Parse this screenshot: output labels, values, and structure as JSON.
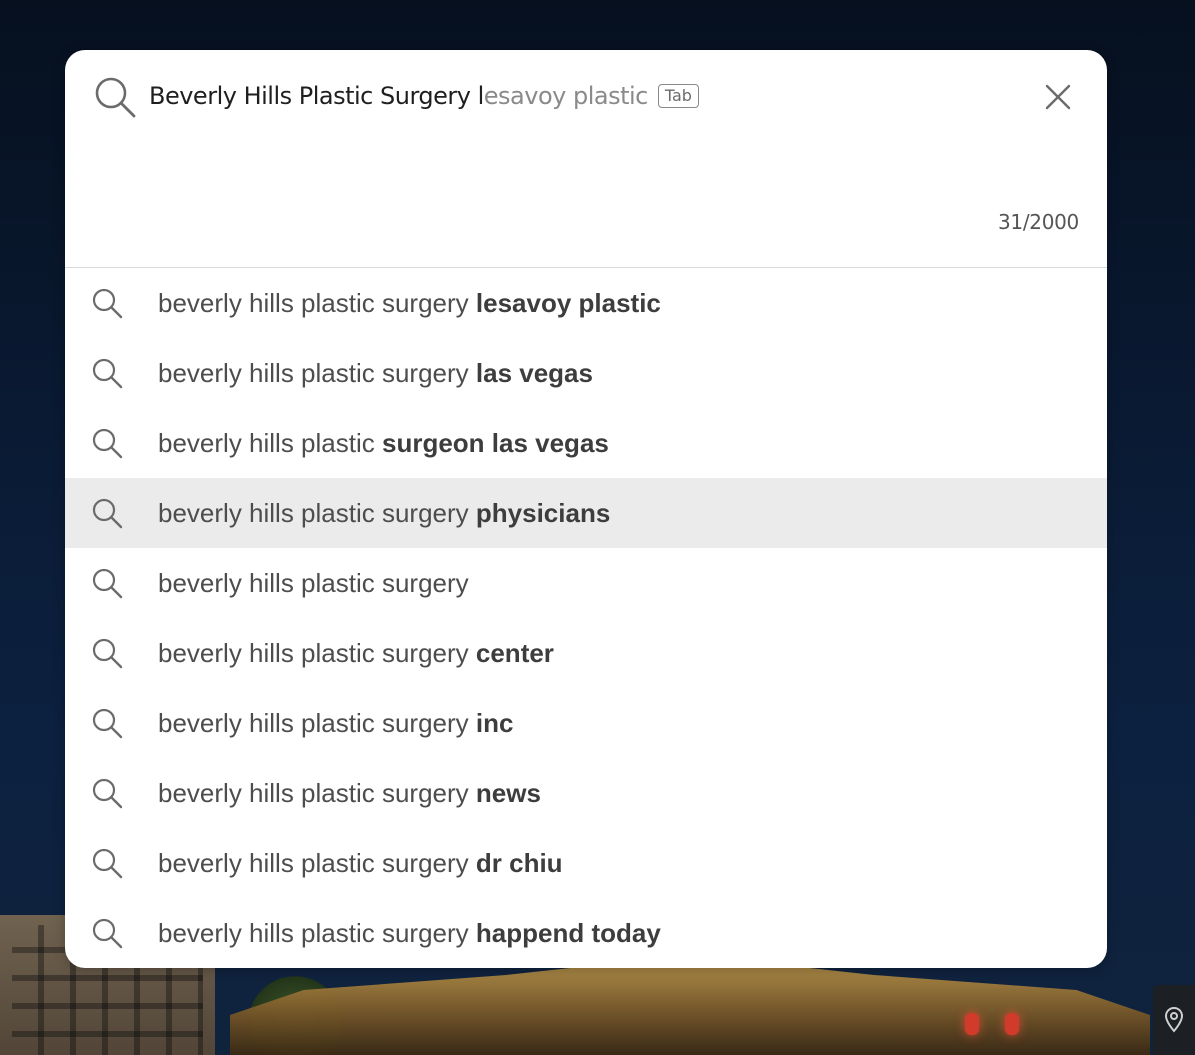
{
  "search": {
    "typed_text": "Beverly Hills Plastic Surgery l",
    "completion_text": "esavoy plastic",
    "tab_hint": "Tab",
    "char_counter": "31/2000"
  },
  "suggestions": [
    {
      "prefix": "beverly hills plastic surgery ",
      "bold": "lesavoy plastic",
      "highlighted": false
    },
    {
      "prefix": "beverly hills plastic surgery ",
      "bold": "las vegas",
      "highlighted": false
    },
    {
      "prefix": "beverly hills plastic ",
      "bold": "surgeon las vegas",
      "highlighted": false
    },
    {
      "prefix": "beverly hills plastic surgery ",
      "bold": "physicians",
      "highlighted": true
    },
    {
      "prefix": "beverly hills plastic surgery",
      "bold": "",
      "highlighted": false
    },
    {
      "prefix": "beverly hills plastic surgery ",
      "bold": "center",
      "highlighted": false
    },
    {
      "prefix": "beverly hills plastic surgery ",
      "bold": "inc",
      "highlighted": false
    },
    {
      "prefix": "beverly hills plastic surgery ",
      "bold": "news",
      "highlighted": false
    },
    {
      "prefix": "beverly hills plastic surgery ",
      "bold": "dr chiu",
      "highlighted": false
    },
    {
      "prefix": "beverly hills plastic surgery ",
      "bold": "happend today",
      "highlighted": false
    }
  ],
  "icons": {
    "search": "search-icon",
    "close": "close-icon",
    "map_pin": "map-pin-icon"
  },
  "colors": {
    "highlight_row": "#ebebeb",
    "completion_text": "#8a8a8a",
    "suggestion_text": "#4d4d4d"
  }
}
